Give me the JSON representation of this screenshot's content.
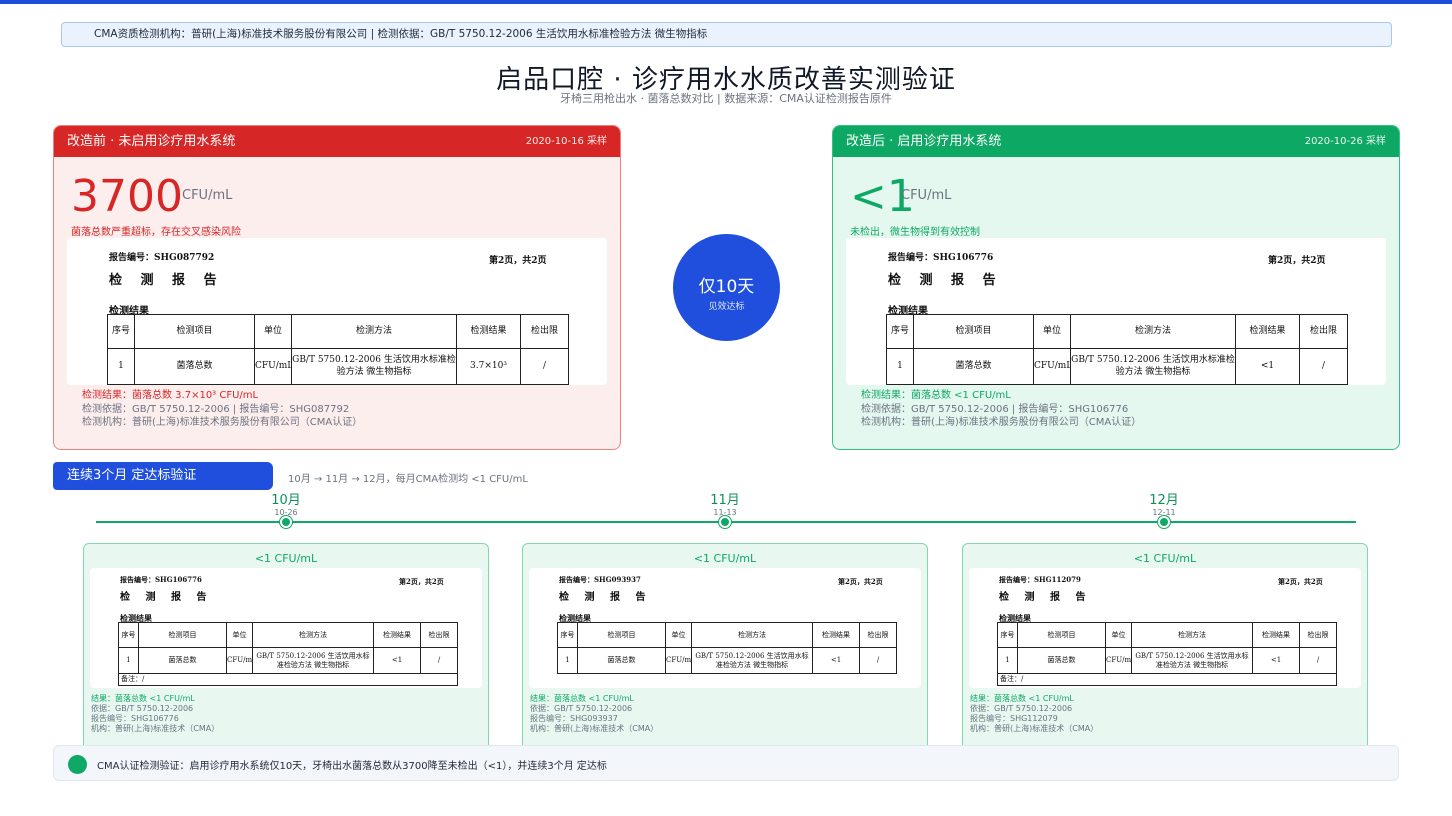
{
  "cma_bar": {
    "text": "CMA资质检测机构：普研(上海)标准技术服务股份有限公司  |  检测依据：GB/T 5750.12-2006 生活饮用水标准检验方法 微生物指标"
  },
  "header": {
    "title": "启品口腔 · 诊疗用水水质改善实测验证",
    "subtitle": "牙椅三用枪出水 · 菌落总数对比  |  数据来源：CMA认证检测报告原件"
  },
  "before": {
    "title": "改造前 · 未启用诊疗用水系统",
    "date": "2020-10-16 采样",
    "value": "3700",
    "unit": "CFU/mL",
    "note": "菌落总数严重超标，存在交叉感染风险",
    "report": {
      "no": "报告编号：SHG087792",
      "page": "第2页，共2页",
      "title": "检 测 报 告",
      "section": "检测结果",
      "cols": [
        "序号",
        "检测项目",
        "单位",
        "检测方法",
        "检测结果",
        "检出限"
      ],
      "row": [
        "1",
        "菌落总数",
        "CFU/mL",
        "GB/T 5750.12-2006 生活饮用水标准检验方法 微生物指标",
        "3.7×10³",
        "/"
      ]
    },
    "result": "检测结果：菌落总数 3.7×10³ CFU/mL",
    "basis": "检测依据：GB/T 5750.12-2006  |  报告编号：SHG087792",
    "agency": "检测机构：普研(上海)标准技术服务股份有限公司（CMA认证）"
  },
  "after": {
    "title": "改造后 · 启用诊疗用水系统",
    "date": "2020-10-26 采样",
    "value": "<1",
    "unit": "CFU/mL",
    "note": "未检出，微生物得到有效控制",
    "report": {
      "no": "报告编号：SHG106776",
      "page": "第2页，共2页",
      "title": "检 测 报 告",
      "section": "检测结果",
      "cols": [
        "序号",
        "检测项目",
        "单位",
        "检测方法",
        "检测结果",
        "检出限"
      ],
      "row": [
        "1",
        "菌落总数",
        "CFU/mL",
        "GB/T 5750.12-2006 生活饮用水标准检验方法 微生物指标",
        "<1",
        "/"
      ]
    },
    "result": "检测结果：菌落总数 <1 CFU/mL",
    "basis": "检测依据：GB/T 5750.12-2006  |  报告编号：SHG106776",
    "agency": "检测机构：普研(上海)标准技术服务股份有限公司（CMA认证）"
  },
  "badge": {
    "main": "仅10天",
    "sub": "见效达标"
  },
  "section": {
    "label": "连续3个月   定达标验证",
    "desc": "10月 → 11月 → 12月，每月CMA检测均 <1 CFU/mL"
  },
  "timeline": [
    {
      "month": "10月",
      "date": "10-26"
    },
    {
      "month": "11月",
      "date": "11-13"
    },
    {
      "month": "12月",
      "date": "12-11"
    }
  ],
  "monthly": [
    {
      "head": "<1 CFU/mL",
      "report": {
        "no": "报告编号：SHG106776",
        "page": "第2页，共2页",
        "title": "检 测 报 告",
        "section": "检测结果",
        "cols": [
          "序号",
          "检测项目",
          "单位",
          "检测方法",
          "检测结果",
          "检出限"
        ],
        "row": [
          "1",
          "菌落总数",
          "CFU/mL",
          "GB/T 5750.12-2006 生活饮用水标准检验方法 微生物指标",
          "<1",
          "/"
        ],
        "remark": "备注：/"
      },
      "result": "结果：菌落总数 <1 CFU/mL",
      "basis": "依据：GB/T 5750.12-2006",
      "no": "报告编号：SHG106776",
      "agency": "机构：普研(上海)标准技术（CMA）"
    },
    {
      "head": "<1 CFU/mL",
      "report": {
        "no": "报告编号：SHG093937",
        "page": "第2页，共2页",
        "title": "检 测 报 告",
        "section": "检测结果",
        "cols": [
          "序号",
          "检测项目",
          "单位",
          "检测方法",
          "检测结果",
          "检出限"
        ],
        "row": [
          "1",
          "菌落总数",
          "CFU/mL",
          "GB/T 5750.12-2006 生活饮用水标准检验方法 微生物指标",
          "<1",
          "/"
        ],
        "remark": "备注：/"
      },
      "result": "结果：菌落总数 <1 CFU/mL",
      "basis": "依据：GB/T 5750.12-2006",
      "no": "报告编号：SHG093937",
      "agency": "机构：普研(上海)标准技术（CMA）"
    },
    {
      "head": "<1 CFU/mL",
      "report": {
        "no": "报告编号：SHG112079",
        "page": "第2页，共2页",
        "title": "检 测 报 告",
        "section": "检测结果",
        "cols": [
          "序号",
          "检测项目",
          "单位",
          "检测方法",
          "检测结果",
          "检出限"
        ],
        "row": [
          "1",
          "菌落总数",
          "CFU/mL",
          "GB/T 5750.12-2006 生活饮用水标准检验方法 微生物指标",
          "<1",
          "/"
        ],
        "remark": "备注：/"
      },
      "result": "结果：菌落总数 <1 CFU/mL",
      "basis": "依据：GB/T 5750.12-2006",
      "no": "报告编号：SHG112079",
      "agency": "机构：普研(上海)标准技术（CMA）"
    }
  ],
  "summary": {
    "text": "CMA认证检测验证：启用诊疗用水系统仅10天，牙椅出水菌落总数从3700降至未检出（<1），并连续3个月   定达标"
  },
  "colors": {
    "red": "#d62626",
    "green": "#0ea865",
    "blue": "#1f4fdc"
  }
}
